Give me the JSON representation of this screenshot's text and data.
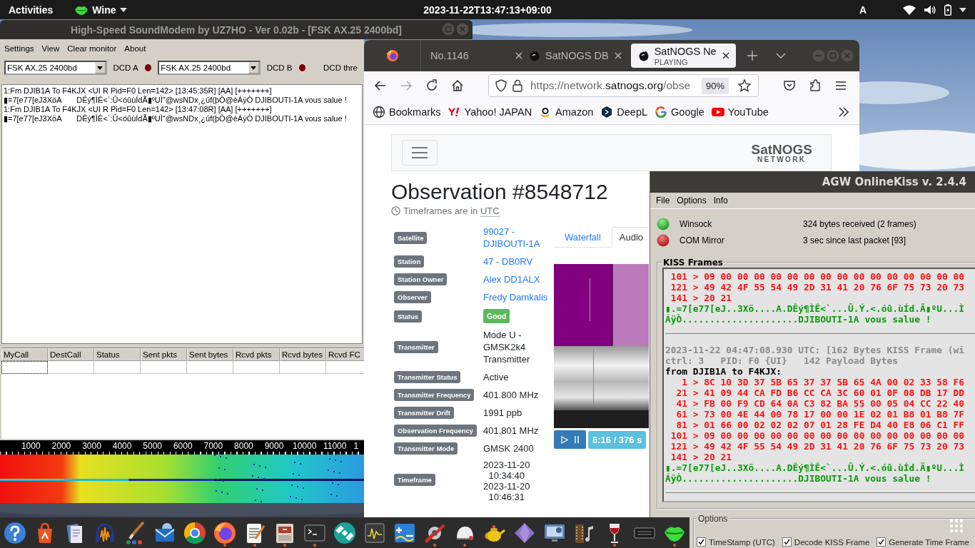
{
  "top_bar": {
    "activities": "Activities",
    "app_menu": "Wine",
    "clock": "2023-11-22T13:47:13+09:00",
    "keyboard_layout": "A"
  },
  "soundmodem": {
    "title": "High-Speed SoundModem by UZ7HO - Ver 0.02b - [FSK AX.25 2400bd]",
    "menu": [
      "Settings",
      "View",
      "Clear monitor",
      "About"
    ],
    "modems": [
      {
        "mode": "FSK AX.25 2400bd",
        "dcd_label": "DCD A",
        "dcd": false
      },
      {
        "mode": "FSK AX.25 2400bd",
        "dcd_label": "DCD B",
        "dcd": false
      }
    ],
    "threshold_label": "DCD thre",
    "monitor_lines": [
      "1:Fm DJIB1A To F4KJX <UI R Pid=F0 Len=142> [13:45:35R] [AA] [+++++++]",
      "▮=7[e77[eJ3XöA       DÊý¶ÌÊ<`:Û<óûùÍdÃ▮ºUÌ\"@wsNDx¸¿úf(þÒ@èÁÿÒ DJIBOUTI-1A vous salue !",
      "1:Fm DJIB1A To F4KJX <UI R Pid=F0 Len=142> [13:47:08R] [AA] [+++++++]",
      "▮=7[e77[eJ3XöA       DÊý¶ÌÊ<`:Û<óûùÍdÃ▮ºUÌ\"@wsNDx¸¿úf(þÒ@èÁÿÒ DJIBOUTI-1A vous salue !"
    ],
    "table": {
      "columns": [
        "MyCall",
        "DestCall",
        "Status",
        "Sent pkts",
        "Sent bytes",
        "Rcvd pkts",
        "Rcvd bytes",
        "Rcvd FC"
      ]
    },
    "waterfall_scale": [
      "1000",
      "2000",
      "3000",
      "4000",
      "5000",
      "6000",
      "7000",
      "8000",
      "9000",
      "10000",
      "11000",
      "1"
    ]
  },
  "browser": {
    "tabs": [
      {
        "label": "No.1146",
        "selected": false
      },
      {
        "label": "SatNOGS DB",
        "selected": false
      },
      {
        "label": "SatNOGS Ne",
        "status": "PLAYING",
        "selected": true
      }
    ],
    "nav": {
      "forward_disabled": true
    },
    "url_parts": [
      {
        "text": "https://network.",
        "strong": false
      },
      {
        "text": "satnogs.org",
        "strong": true
      },
      {
        "text": "/obse",
        "strong": false
      }
    ],
    "zoom": "90%",
    "bookmarks": [
      {
        "kind": "folder",
        "label": "Bookmarks"
      },
      {
        "kind": "yahoo",
        "label": "Yahoo! JAPAN"
      },
      {
        "kind": "amazon",
        "label": "Amazon"
      },
      {
        "kind": "deepl",
        "label": "DeepL"
      },
      {
        "kind": "google",
        "label": "Google"
      },
      {
        "kind": "youtube",
        "label": "YouTube"
      }
    ],
    "page": {
      "logo": "SatNOGS",
      "logo_sub": "NETWORK",
      "title": "Observation #8548712",
      "timezone_note": "Timeframes are in ",
      "timezone_abbr": "UTC",
      "details": [
        {
          "label": "Satellite",
          "kind": "link",
          "value": [
            "99027 -",
            "DJIBOUTI-1A"
          ]
        },
        {
          "label": "Station",
          "kind": "link",
          "value": [
            "47 - DB0RV"
          ]
        },
        {
          "label": "Station Owner",
          "kind": "link",
          "value": [
            "Alex DD1ALX"
          ]
        },
        {
          "label": "Observer",
          "kind": "link",
          "value": [
            "Fredy Damkalis"
          ]
        },
        {
          "label": "Status",
          "kind": "badge",
          "value": [
            "Good"
          ]
        },
        {
          "label": "Transmitter",
          "kind": "text",
          "value": [
            "Mode U -",
            "GMSK2k4",
            "Transmitter"
          ]
        },
        {
          "label": "Transmitter Status",
          "kind": "text",
          "value": [
            "Active"
          ]
        },
        {
          "label": "Transmitter Frequency",
          "kind": "text",
          "value": [
            "401.800 MHz"
          ]
        },
        {
          "label": "Transmitter Drift",
          "kind": "text",
          "value": [
            "1991 ppb"
          ]
        },
        {
          "label": "Observation Frequency",
          "kind": "text",
          "value": [
            "401.801 MHz"
          ]
        },
        {
          "label": "Transmitter Mode",
          "kind": "text",
          "value": [
            "GMSK 2400"
          ]
        },
        {
          "label": "Timeframe",
          "kind": "range",
          "value": [
            "2023-11-20",
            "10:34:40",
            "2023-11-20",
            "10:46:31"
          ]
        }
      ],
      "media_tabs": [
        {
          "label": "Waterfall",
          "selected": false
        },
        {
          "label": "Audio",
          "selected": true
        }
      ],
      "player_time": "6:16 / 376 s"
    }
  },
  "agw": {
    "title": "AGW OnlineKiss v. 2.4.4",
    "menu": [
      "File",
      "Options",
      "Info"
    ],
    "links": [
      {
        "name": "Winsock",
        "on": true,
        "info": "324 bytes received (2 frames)"
      },
      {
        "name": "COM Mirror",
        "on": false,
        "info": "3 sec since last packet [93]"
      }
    ],
    "frames_title": "KISS Frames",
    "frame_lines": [
      {
        "kind": "hex",
        "text": " 101 > 09 00 00 00 00 00 00 00 00 00 00 00 00 00 00 00"
      },
      {
        "kind": "hex",
        "text": " 121 > 49 42 4F 55 54 49 2D 31 41 20 76 6F 75 73 20 73"
      },
      {
        "kind": "hex",
        "text": " 141 > 20 21"
      },
      {
        "kind": "ascii",
        "text": "▮.=7[e77[eJ..3Xö....A.DÊý¶ÌÊ<`...Û.Ý.<.óû.ùÍd.Ã▮ºU...Ì"
      },
      {
        "kind": "ascii",
        "text": "ÁÿÒ.....................DJIBOUTI-1A vous salue !"
      },
      {
        "kind": "rule"
      },
      {
        "kind": "header",
        "text": "2023-11-22 04:47:08.930 UTC: [162 Bytes KISS Frame (wi"
      },
      {
        "kind": "header",
        "text": "ctrl: 3   PID: F0 {UI}   142 Payload Bytes"
      },
      {
        "kind": "route",
        "text": "from DJIB1A to F4KJX:"
      },
      {
        "kind": "hex",
        "text": "   1 > 8C 10 3D 37 5B 65 37 37 5B 65 4A 00 02 33 58 F6"
      },
      {
        "kind": "hex",
        "text": "  21 > 41 09 44 CA FD B6 CC CA 3C 60 01 0F 08 DB 17 DD"
      },
      {
        "kind": "hex",
        "text": "  41 > FB 00 F9 CD 64 0A C3 82 BA 55 00 05 04 CC 22 40"
      },
      {
        "kind": "hex",
        "text": "  61 > 73 00 4E 44 00 78 17 00 00 1E 02 01 B8 01 B8 7F"
      },
      {
        "kind": "hex",
        "text": "  81 > 01 66 00 02 02 02 07 01 28 FE D4 40 E8 06 C1 FF"
      },
      {
        "kind": "hex",
        "text": " 101 > 09 00 00 00 00 00 00 00 00 00 00 00 00 00 00 00"
      },
      {
        "kind": "hex",
        "text": " 121 > 49 42 4F 55 54 49 2D 31 41 20 76 6F 75 73 20 73"
      },
      {
        "kind": "hex",
        "text": " 141 > 20 21"
      },
      {
        "kind": "ascii",
        "text": "▮.=7[e77[eJ..3Xö....A.DÊý¶ÌÊ<`...Û.Ý.<.óû.ùÍd.Ã▮ºU...Ì"
      },
      {
        "kind": "ascii",
        "text": "ÁÿÒ.....................DJIBOUTI-1A vous salue !"
      },
      {
        "kind": "rule"
      }
    ],
    "options_title": "Options",
    "options": [
      {
        "label": "TimeStamp (UTC)",
        "checked": true
      },
      {
        "label": "Decode KISS Frame",
        "checked": true
      },
      {
        "label": "Generate Time Frame",
        "checked": true
      }
    ]
  },
  "dock": {
    "items": [
      {
        "kind": "help",
        "running": false
      },
      {
        "kind": "store",
        "running": false
      },
      {
        "kind": "docs",
        "running": false
      },
      {
        "kind": "audio",
        "running": false
      },
      {
        "kind": "brush",
        "running": false
      },
      {
        "kind": "mail",
        "running": false
      },
      {
        "kind": "chrome",
        "running": false
      },
      {
        "kind": "firefox",
        "running": true
      },
      {
        "kind": "editor",
        "running": true
      },
      {
        "kind": "cabinet",
        "running": true
      },
      {
        "kind": "terminal",
        "running": true
      },
      {
        "kind": "satellite",
        "running": false
      },
      {
        "kind": "scope",
        "running": false
      },
      {
        "kind": "plusminus",
        "running": false
      },
      {
        "kind": "tools",
        "running": true
      },
      {
        "kind": "mouse",
        "running": true
      },
      {
        "kind": "teapot",
        "running": false
      },
      {
        "kind": "diamond",
        "running": false
      },
      {
        "kind": "monitor",
        "running": false
      },
      {
        "kind": "film",
        "running": false
      },
      {
        "kind": "wineglass",
        "running": true
      },
      {
        "kind": "drive",
        "running": false
      },
      {
        "kind": "wine",
        "running": true
      }
    ]
  }
}
